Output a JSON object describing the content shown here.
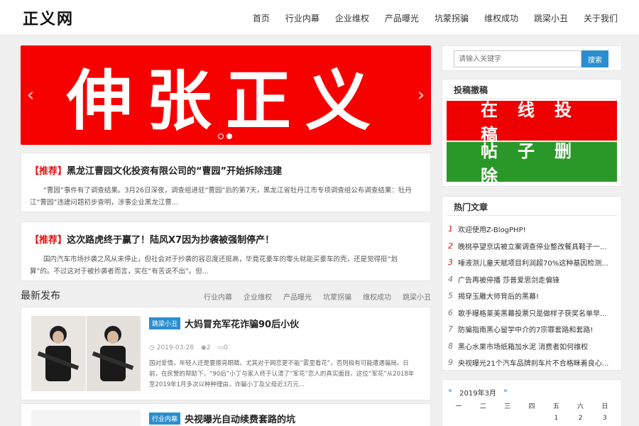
{
  "site": {
    "logo": "正义网"
  },
  "nav": [
    "首页",
    "行业内幕",
    "企业维权",
    "产品曝光",
    "坑蒙拐骗",
    "维权成功",
    "跳梁小丑",
    "关于我们"
  ],
  "banner": {
    "text": "伸张正义",
    "prev": "‹",
    "next": "›"
  },
  "recommend": [
    {
      "tag": "【推荐】",
      "title": "黑龙江曹园文化投资有限公司的“曹园”开始拆除违建",
      "desc": "“曹园”事件有了调查结果。3月26日深夜，调查组进驻“曹园”后的第7天，黑龙江省牡丹江市专项调查组公布调查结果：牡丹江“曹园”违建问题初步查明，涉事企业黑龙江曹..."
    },
    {
      "tag": "【推荐】",
      "title": "这次路虎终于赢了！陆风X7因为抄袭被强制停产！",
      "desc": "国内汽车市场抄袭之风从未停止，但社会对于抄袭的容忍度还挺高，毕竟花豪车的零头就能买豪车的壳，还是觉得挺“划算”的。不过这对于被抄袭者而言，实在“有苦说不出”。但..."
    }
  ],
  "latest": {
    "title": "最新发布",
    "cats": [
      "行业内幕",
      "企业维权",
      "产品曝光",
      "坑蒙拐骗",
      "维权成功",
      "跳梁小丑"
    ],
    "posts": [
      {
        "badge": "跳梁小丑",
        "title": "大妈冒充军花诈骗90后小伙",
        "date": "2019-03-28",
        "views": "2",
        "comments": "0",
        "desc": "国对爱情，年轻人还是要擦亮眼睛。尤其对于网恋更不能“雾里看花”，否则极有可能遭遇骗局。日前，在民警的帮助下，“90后”小丁与家人终于认清了“军花”恋人的真实面目。这位“军花”从2018年至2019年1月多次以种种理由，诈骗小丁及父母近3万元..."
      },
      {
        "badge": "行业内幕",
        "title": "央视曝光自动续费套路的坑"
      }
    ]
  },
  "search": {
    "placeholder": "请输入关键字",
    "button": "搜索"
  },
  "tougao": {
    "title": "投稿撤稿",
    "submit": "在线投稿",
    "delete": "帖子删除"
  },
  "hot": {
    "title": "热门文章",
    "items": [
      {
        "num": "1",
        "text": "欢迎使用Z-BlogPHP!"
      },
      {
        "num": "2",
        "text": "晚桃亭望京店被立案调查停业整改餐具鞋子一..."
      },
      {
        "num": "3",
        "text": "唾液测儿童天赋项目利润超70%这种基因检测..."
      },
      {
        "num": "4",
        "text": "广告再被停播 莎普爱思剑走偏锋"
      },
      {
        "num": "5",
        "text": "揭穿玉雕大师背后的黑幕!"
      },
      {
        "num": "6",
        "text": "歌手曝格莱美黑幕投票只是做样子获奖名单早..."
      },
      {
        "num": "7",
        "text": "防骗指南黑心留学中介的7宗罪套路和套路!"
      },
      {
        "num": "8",
        "text": "黑心水果市场纸箱加水泥 消费者如何维权"
      },
      {
        "num": "9",
        "text": "央视曝光21个汽车品牌刹车片不合格眯着良心..."
      }
    ]
  },
  "calendar": {
    "prev": "«",
    "month": "2019年3月",
    "next": "»",
    "weekdays": [
      "一",
      "二",
      "三",
      "四",
      "五",
      "六",
      "日"
    ],
    "days": [
      "",
      "",
      "",
      "",
      "1",
      "2",
      "3"
    ]
  }
}
